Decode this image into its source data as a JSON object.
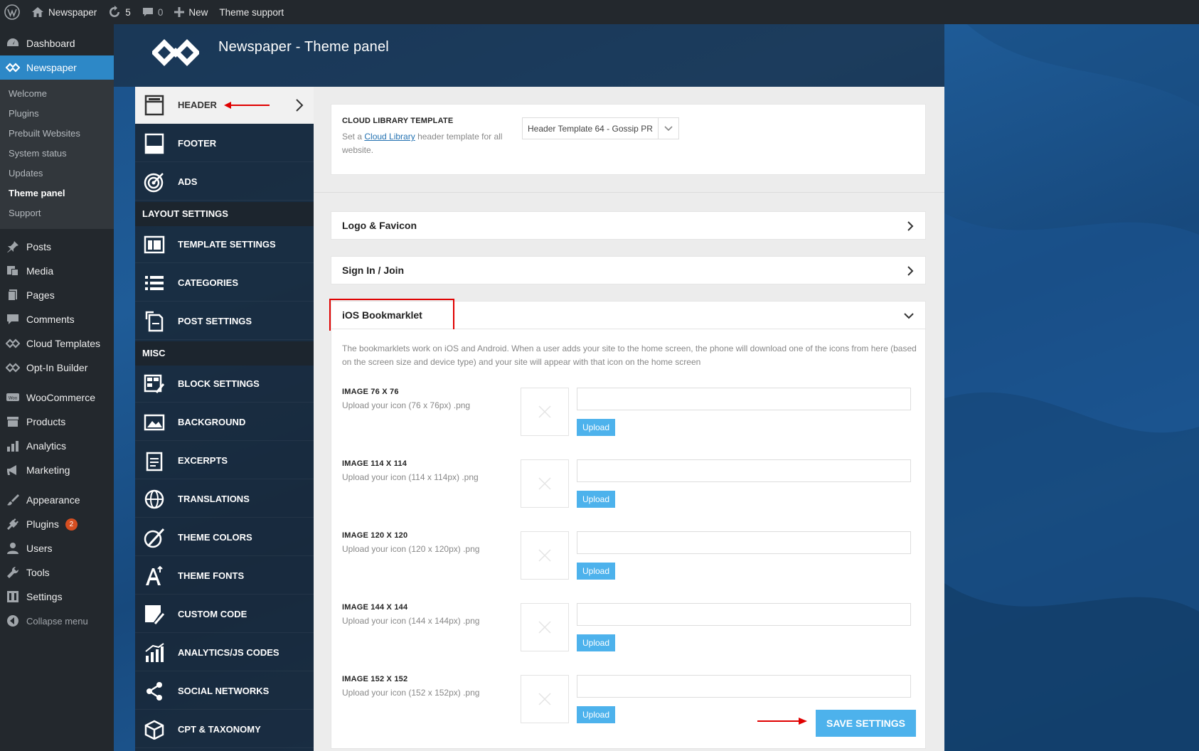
{
  "adminbar": {
    "site_name": "Newspaper",
    "updates_count": "5",
    "comments_count": "0",
    "new_label": "New",
    "theme_support": "Theme support"
  },
  "wpmenu": {
    "dashboard": "Dashboard",
    "newspaper": "Newspaper",
    "submenu": [
      "Welcome",
      "Plugins",
      "Prebuilt Websites",
      "System status",
      "Updates",
      "Theme panel",
      "Support"
    ],
    "group1": [
      "Posts",
      "Media",
      "Pages",
      "Comments",
      "Cloud Templates",
      "Opt-In Builder"
    ],
    "group2": [
      "WooCommerce",
      "Products",
      "Analytics",
      "Marketing"
    ],
    "group3": [
      "Appearance",
      "Plugins",
      "Users",
      "Tools",
      "Settings"
    ],
    "plugins_badge": "2",
    "collapse": "Collapse menu"
  },
  "brand": {
    "title": "Newspaper - Theme panel"
  },
  "panel_nav": {
    "header": "HEADER",
    "footer": "FOOTER",
    "ads": "ADS",
    "layout_section": "LAYOUT SETTINGS",
    "template_settings": "TEMPLATE SETTINGS",
    "categories": "CATEGORIES",
    "post_settings": "POST SETTINGS",
    "misc_section": "MISC",
    "block_settings": "BLOCK SETTINGS",
    "background": "BACKGROUND",
    "excerpts": "EXCERPTS",
    "translations": "TRANSLATIONS",
    "theme_colors": "THEME COLORS",
    "theme_fonts": "THEME FONTS",
    "custom_code": "CUSTOM CODE",
    "analytics": "ANALYTICS/JS CODES",
    "social": "SOCIAL NETWORKS",
    "cpt": "CPT & TAXONOMY"
  },
  "cloud": {
    "label": "CLOUD LIBRARY TEMPLATE",
    "desc_pre": "Set a ",
    "desc_link": "Cloud Library",
    "desc_post": " header template for all website.",
    "selected": "Header Template 64 - Gossip PR"
  },
  "sections": {
    "logo": "Logo & Favicon",
    "signin": "Sign In / Join",
    "ios": "iOS Bookmarklet"
  },
  "ios": {
    "intro": "The bookmarklets work on iOS and Android. When a user adds your site to the home screen, the phone will download one of the icons from here (based on the screen size and device type) and your site will appear with that icon on the home screen",
    "images": [
      {
        "label": "IMAGE 76 X 76",
        "desc": "Upload your icon (76 x 76px) .png"
      },
      {
        "label": "IMAGE 114 X 114",
        "desc": "Upload your icon (114 x 114px) .png"
      },
      {
        "label": "IMAGE 120 X 120",
        "desc": "Upload your icon (120 x 120px) .png"
      },
      {
        "label": "IMAGE 144 X 144",
        "desc": "Upload your icon (144 x 144px) .png"
      },
      {
        "label": "IMAGE 152 X 152",
        "desc": "Upload your icon (152 x 152px) .png"
      }
    ],
    "upload_label": "Upload"
  },
  "save_label": "SAVE SETTINGS",
  "colors": {
    "accent": "#4db2ec",
    "wp_blue": "#2d88c7",
    "annotation_red": "#e00000"
  }
}
